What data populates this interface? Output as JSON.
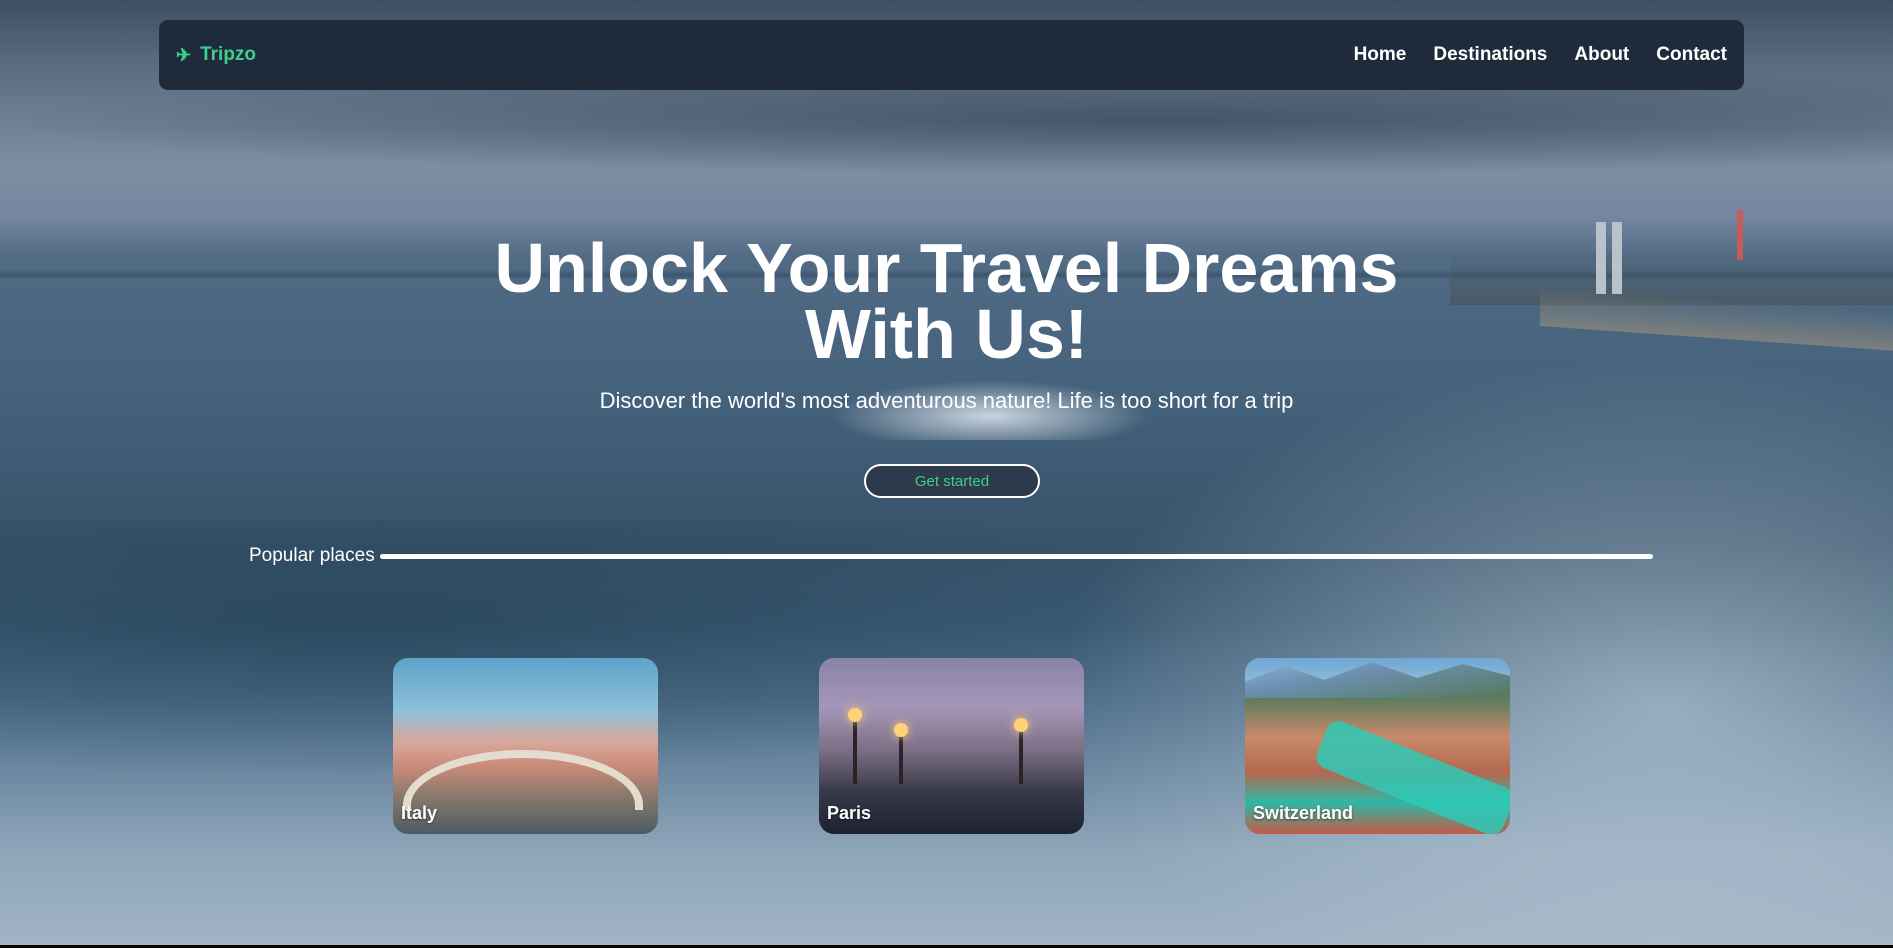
{
  "nav": {
    "brand": "Tripzo",
    "brand_icon": "airplane-icon",
    "links": [
      "Home",
      "Destinations",
      "About",
      "Contact"
    ]
  },
  "hero": {
    "headline_line1": "Unlock Your Travel Dreams",
    "headline_line2": "With Us!",
    "subtitle": "Discover the world's most adventurous nature! Life is too short for a trip",
    "cta_label": "Get started"
  },
  "popular": {
    "section_label": "Popular places",
    "places": [
      "Italy",
      "Paris",
      "Switzerland"
    ]
  },
  "colors": {
    "accent": "#3ecf8e",
    "navbar_bg": "#1f2a3a",
    "text": "#ffffff"
  }
}
